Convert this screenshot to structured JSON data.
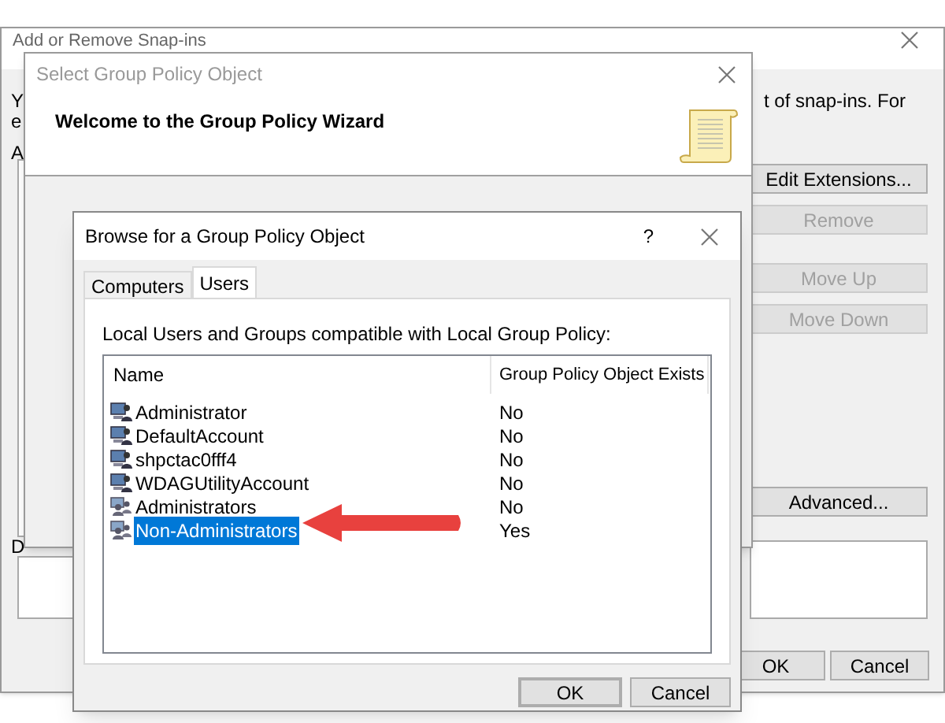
{
  "snapins_window": {
    "title": "Add or Remove Snap-ins",
    "fragments": [
      "Y",
      "e",
      "A",
      "D"
    ],
    "intro_tail": "t of snap-ins. For",
    "buttons": [
      {
        "label": "Edit Extensions...",
        "disabled": false
      },
      {
        "label": "Remove",
        "disabled": true
      },
      {
        "label": "Move Up",
        "disabled": true
      },
      {
        "label": "Move Down",
        "disabled": true
      },
      {
        "label": "Advanced...",
        "disabled": false
      }
    ],
    "ok": "OK",
    "cancel": "Cancel"
  },
  "wizard_window": {
    "title": "Select Group Policy Object",
    "heading": "Welcome to the Group Policy Wizard"
  },
  "browse_dialog": {
    "title": "Browse for a Group Policy Object",
    "help": "?",
    "tabs": [
      {
        "label": "Computers",
        "selected": false
      },
      {
        "label": "Users",
        "selected": true
      }
    ],
    "caption": "Local Users and Groups compatible with Local Group Policy:",
    "columns": [
      "Name",
      "Group Policy Object Exists"
    ],
    "rows": [
      {
        "name": "Administrator",
        "exists": "No",
        "kind": "user",
        "selected": false
      },
      {
        "name": "DefaultAccount",
        "exists": "No",
        "kind": "user",
        "selected": false
      },
      {
        "name": "shpctac0fff4",
        "exists": "No",
        "kind": "user",
        "selected": false
      },
      {
        "name": "WDAGUtilityAccount",
        "exists": "No",
        "kind": "user",
        "selected": false
      },
      {
        "name": "Administrators",
        "exists": "No",
        "kind": "group",
        "selected": false
      },
      {
        "name": "Non-Administrators",
        "exists": "Yes",
        "kind": "group",
        "selected": true
      }
    ],
    "ok": "OK",
    "cancel": "Cancel"
  }
}
